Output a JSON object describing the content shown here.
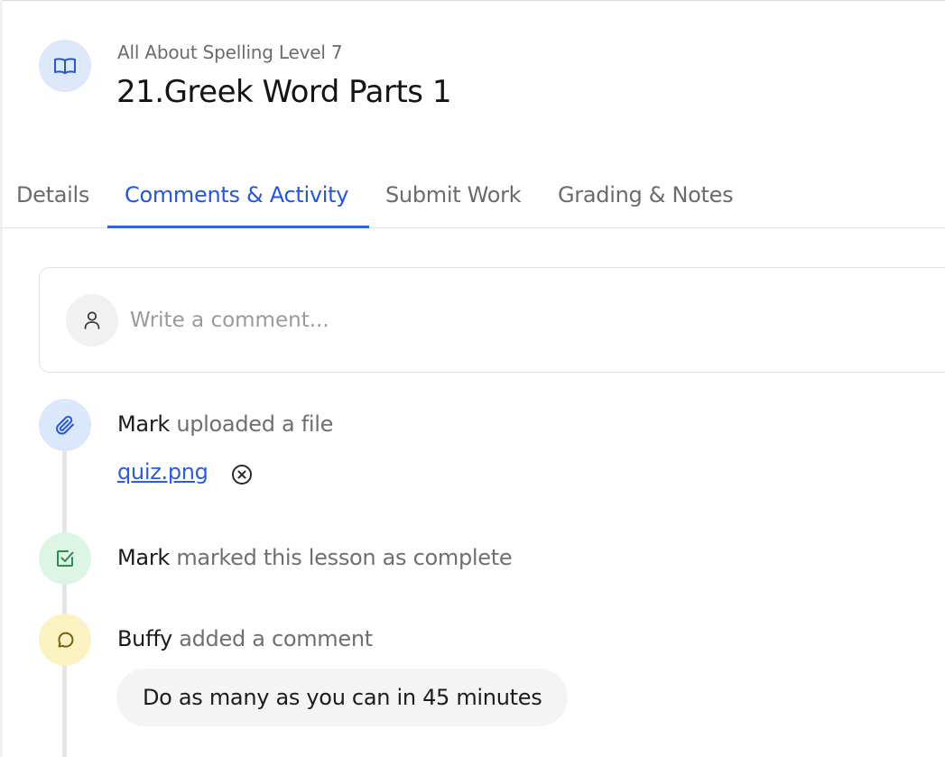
{
  "header": {
    "icon": "book-open-icon",
    "course": "All About Spelling Level 7",
    "lesson_title": "21.Greek Word Parts 1"
  },
  "tabs": [
    {
      "label": "Details",
      "active": false
    },
    {
      "label": "Comments & Activity",
      "active": true
    },
    {
      "label": "Submit Work",
      "active": false
    },
    {
      "label": "Grading & Notes",
      "active": false
    }
  ],
  "comment_box": {
    "avatar_icon": "user-icon",
    "placeholder": "Write a comment..."
  },
  "activity": [
    {
      "icon": "paperclip-icon",
      "actor": "Mark",
      "action": "uploaded a file",
      "file_name": "quiz.png",
      "remove_icon": "close-circle-icon"
    },
    {
      "icon": "check-square-icon",
      "actor": "Mark",
      "action": "marked this lesson as complete"
    },
    {
      "icon": "message-circle-icon",
      "actor": "Buffy",
      "action": "added a comment",
      "comment": "Do as many as you can in 45 minutes"
    }
  ],
  "colors": {
    "accent": "#2457d8",
    "upload_icon_bg": "#dbe7fb",
    "complete_icon_bg": "#dcf5e5",
    "comment_icon_bg": "#fbf4c2"
  }
}
